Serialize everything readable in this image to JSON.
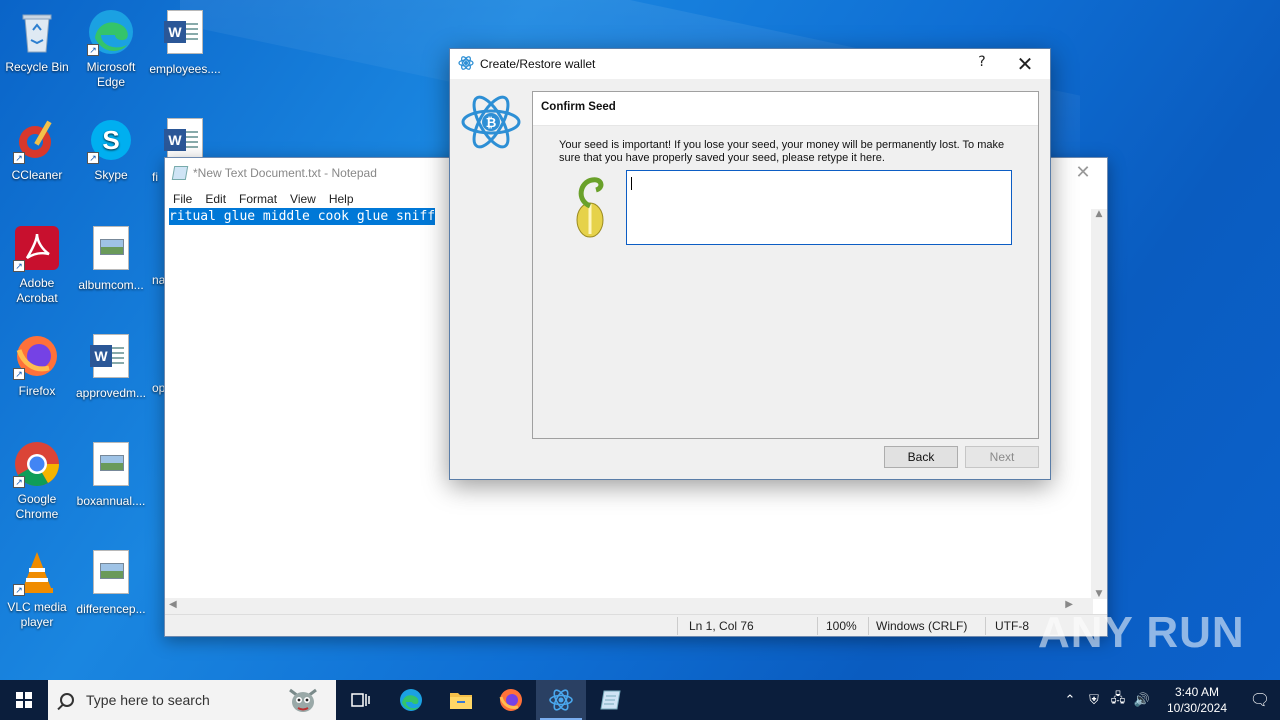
{
  "desktop": {
    "icons": [
      {
        "label": "Recycle Bin",
        "icon": "recycle-bin-icon"
      },
      {
        "label": "Microsoft Edge",
        "icon": "edge-icon"
      },
      {
        "label": "employees....",
        "icon": "word-doc-icon"
      },
      {
        "label": "CCleaner",
        "icon": "ccleaner-icon"
      },
      {
        "label": "Skype",
        "icon": "skype-icon"
      },
      {
        "label": "fi",
        "icon": "word-doc-icon"
      },
      {
        "label": "Adobe Acrobat",
        "icon": "acrobat-icon"
      },
      {
        "label": "albumcom...",
        "icon": "image-doc-icon"
      },
      {
        "label": "na",
        "icon": "image-doc-icon"
      },
      {
        "label": "Firefox",
        "icon": "firefox-icon"
      },
      {
        "label": "approvedm...",
        "icon": "word-doc-icon"
      },
      {
        "label": "op",
        "icon": "doc-icon"
      },
      {
        "label": "Google Chrome",
        "icon": "chrome-icon"
      },
      {
        "label": "boxannual....",
        "icon": "image-doc-icon"
      },
      {
        "label": "VLC media player",
        "icon": "vlc-icon"
      },
      {
        "label": "differencep...",
        "icon": "image-doc-icon"
      }
    ]
  },
  "notepad": {
    "title": "*New Text Document.txt - Notepad",
    "menu": [
      "File",
      "Edit",
      "Format",
      "View",
      "Help"
    ],
    "content": "ritual glue middle cook glue sniff",
    "status": {
      "position": "Ln 1, Col 76",
      "zoom": "100%",
      "line_ending": "Windows (CRLF)",
      "encoding": "UTF-8"
    }
  },
  "dialog": {
    "title": "Create/Restore wallet",
    "help": "?",
    "close": "✕",
    "heading": "Confirm Seed",
    "message": "Your seed is important! If you lose your seed, your money will be permanently lost. To make sure that you have properly saved your seed, please retype it here.",
    "seed_value": "",
    "back_label": "Back",
    "next_label": "Next",
    "next_enabled": false
  },
  "taskbar": {
    "search_placeholder": "Type here to search",
    "time": "3:40 AM",
    "date": "10/30/2024"
  },
  "watermark": "ANY RUN",
  "colors": {
    "desktop": "#0f6fd4",
    "taskbar": "#0b1e3c",
    "selection": "#0078d7",
    "electrum": "#2d8fd5"
  }
}
